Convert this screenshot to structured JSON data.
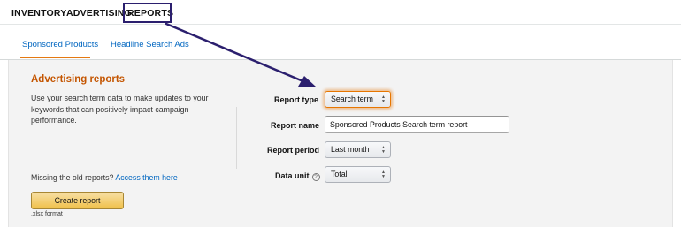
{
  "topnav": {
    "items": [
      {
        "label": "INVENTORY"
      },
      {
        "label": "ADVERTISING"
      },
      {
        "label": "REPORTS"
      }
    ]
  },
  "subtabs": [
    {
      "label": "Sponsored Products",
      "active": true
    },
    {
      "label": "Headline Search Ads",
      "active": false
    }
  ],
  "reports": {
    "heading": "Advertising reports",
    "description": "Use your search term data to make updates to your keywords that can positively impact campaign performance.",
    "missing_text": "Missing the old reports? ",
    "missing_link": "Access them here",
    "create_button": "Create report",
    "format_note": ".xlsx format"
  },
  "form": {
    "report_type": {
      "label": "Report type",
      "value": "Search term"
    },
    "report_name": {
      "label": "Report name",
      "value": "Sponsored Products Search term report"
    },
    "report_period": {
      "label": "Report period",
      "value": "Last month"
    },
    "data_unit": {
      "label": "Data unit",
      "value": "Total"
    }
  },
  "icons": {
    "info": "info-circle-icon",
    "select_arrows": "up-down-chevron-icon"
  },
  "colors": {
    "accent_orange": "#c45500",
    "focus_orange": "#e77600",
    "link_blue": "#0066c0",
    "annotation": "#2b1f6e",
    "button_yellow": "#f0c14b"
  }
}
